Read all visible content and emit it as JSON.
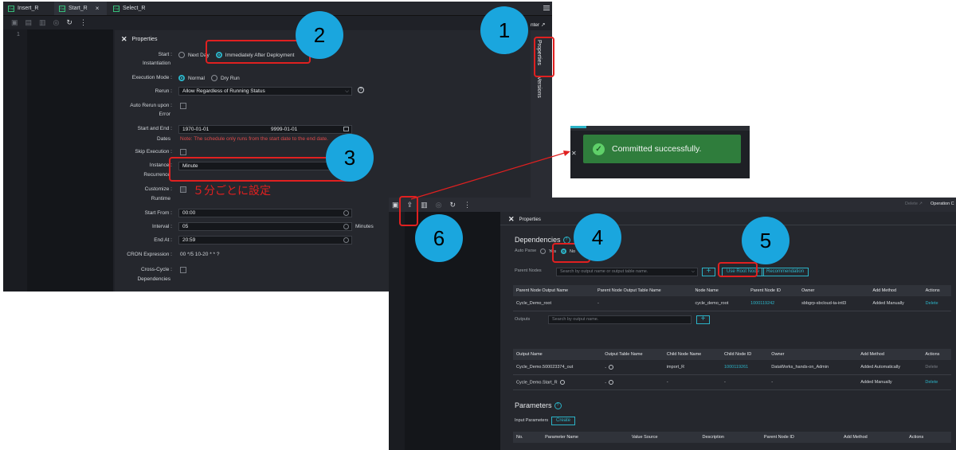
{
  "top_window": {
    "tabs": [
      {
        "icon": "Sql",
        "label": "Insert_R"
      },
      {
        "icon": "Sql",
        "label": "Start_R",
        "active": true,
        "close": "×"
      },
      {
        "icon": "Sql",
        "label": "Select_R"
      }
    ],
    "menu_icon": "hamburger-icon",
    "line_number": "1",
    "right_partial_text": "nter ↗",
    "side_tabs": {
      "properties": "Properties",
      "versions": "Versions"
    },
    "properties": {
      "close": "✕",
      "title": "Properties",
      "start_instantiation": {
        "label_1": "Start",
        "label_2": "Instantiation",
        "options": [
          "Next Day",
          "Immediately After Deployment"
        ],
        "selected": "Immediately After Deployment"
      },
      "execution_mode": {
        "label": "Execution Mode",
        "options": [
          "Normal",
          "Dry Run"
        ],
        "selected": "Normal"
      },
      "rerun": {
        "label": "Rerun",
        "value": "Allow Regardless of Running Status"
      },
      "auto_rerun": {
        "label_1": "Auto Rerun upon",
        "label_2": "Error"
      },
      "dates": {
        "label_1": "Start and End",
        "label_2": "Dates",
        "start": "1970-01-01",
        "end": "9999-01-01",
        "note": "Note: The schedule only runs from the start date to the end date."
      },
      "skip_execution": {
        "label": "Skip Execution"
      },
      "recurrence": {
        "label_1": "Instance",
        "label_2": "Recurrence",
        "value": "Minute"
      },
      "customize_runtime": {
        "label_1": "Customize",
        "label_2": "Runtime"
      },
      "start_from": {
        "label": "Start From",
        "value": "00:00"
      },
      "interval": {
        "label": "Interval",
        "value": "05",
        "unit": "Minutes"
      },
      "end_at": {
        "label": "End At",
        "value": "20:59"
      },
      "cron": {
        "label": "CRON Expression",
        "value": "00 */5 10-20 * * ?"
      },
      "cross_cycle": {
        "label_1": "Cross-Cycle",
        "label_2": "Dependencies"
      }
    }
  },
  "toast": {
    "message": "Committed successfully."
  },
  "bottom_window": {
    "toolbar_right": {
      "partial": "Delete ↗",
      "operation": "Operation C"
    },
    "properties_title": "Properties",
    "close": "✕",
    "dependencies": {
      "title": "Dependencies",
      "auto_parse_label": "Auto Parse",
      "auto_parse_options": [
        "Yes",
        "No"
      ],
      "auto_parse_selected": "No",
      "parent_nodes_label": "Parent Nodes",
      "search_placeholder": "Search by output name or output table name.",
      "use_root_node": "Use Root Node",
      "recommendation": "Recommendation",
      "parent_table": {
        "headers": [
          "Parent Node Output Name",
          "Parent Node Output Table Name",
          "Node Name",
          "Parent Node ID",
          "Owner",
          "Add Method",
          "Actions"
        ],
        "rows": [
          [
            "Cycle_Demo_root",
            "-",
            "cycle_demo_root",
            "1000119242",
            "sbbgrp-sbcloud-ta-intl3",
            "Added Manually",
            "Delete"
          ]
        ]
      },
      "outputs_label": "Outputs",
      "outputs_placeholder": "Search by output name.",
      "output_table": {
        "headers": [
          "Output Name",
          "Output Table Name",
          "Child Node Name",
          "Child Node ID",
          "Owner",
          "Add Method",
          "Actions"
        ],
        "rows": [
          [
            "Cycle_Demo.500023374_out",
            "-",
            "import_R",
            "1000119261",
            "DataWorks_hands-on_Admin",
            "Added Automatically",
            "Delete"
          ],
          [
            "Cycle_Demo.Start_R",
            "-",
            "-",
            "-",
            "-",
            "Added Manually",
            "Delete"
          ]
        ]
      }
    },
    "parameters": {
      "title": "Parameters",
      "input_label": "Input Parameters",
      "create": "Create",
      "headers": [
        "No.",
        "Parameter Name",
        "Value Source",
        "Description",
        "Parent Node ID",
        "Add Method",
        "Actions"
      ]
    }
  },
  "annotations": {
    "callouts": [
      "1",
      "2",
      "3",
      "4",
      "5",
      "6"
    ],
    "japanese_note": "５分ごとに設定",
    "colors": {
      "callout": "#1aa6de",
      "highlight": "#e02020",
      "accent": "#2bb3c7",
      "toast": "#2f7d3c"
    }
  }
}
